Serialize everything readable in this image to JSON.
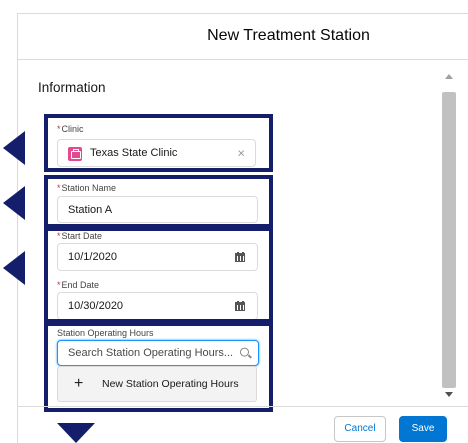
{
  "modal": {
    "title": "New Treatment Station"
  },
  "form": {
    "section_title": "Information",
    "clinic": {
      "label": "Clinic",
      "value": "Texas State Clinic",
      "clear_glyph": "×"
    },
    "station_name": {
      "label": "Station Name",
      "value": "Station A"
    },
    "start_date": {
      "label": "Start Date",
      "value": "10/1/2020"
    },
    "end_date": {
      "label": "End Date",
      "value": "10/30/2020"
    },
    "operating_hours": {
      "label": "Station Operating Hours",
      "placeholder": "Search Station Operating Hours...",
      "new_option": {
        "glyph": "+",
        "label": "New Station Operating Hours"
      }
    },
    "required_marker": "*"
  },
  "footer": {
    "cancel_label": "Cancel",
    "save_label": "Save"
  },
  "icons": {
    "clinic": "clinic-record-icon",
    "calendar": "calendar-icon",
    "search": "search-icon",
    "clear": "close-icon"
  },
  "colors": {
    "accent": "#0176d3",
    "highlight": "#141e6a",
    "required": "#c23934",
    "clinic_icon": "#e4498f"
  }
}
